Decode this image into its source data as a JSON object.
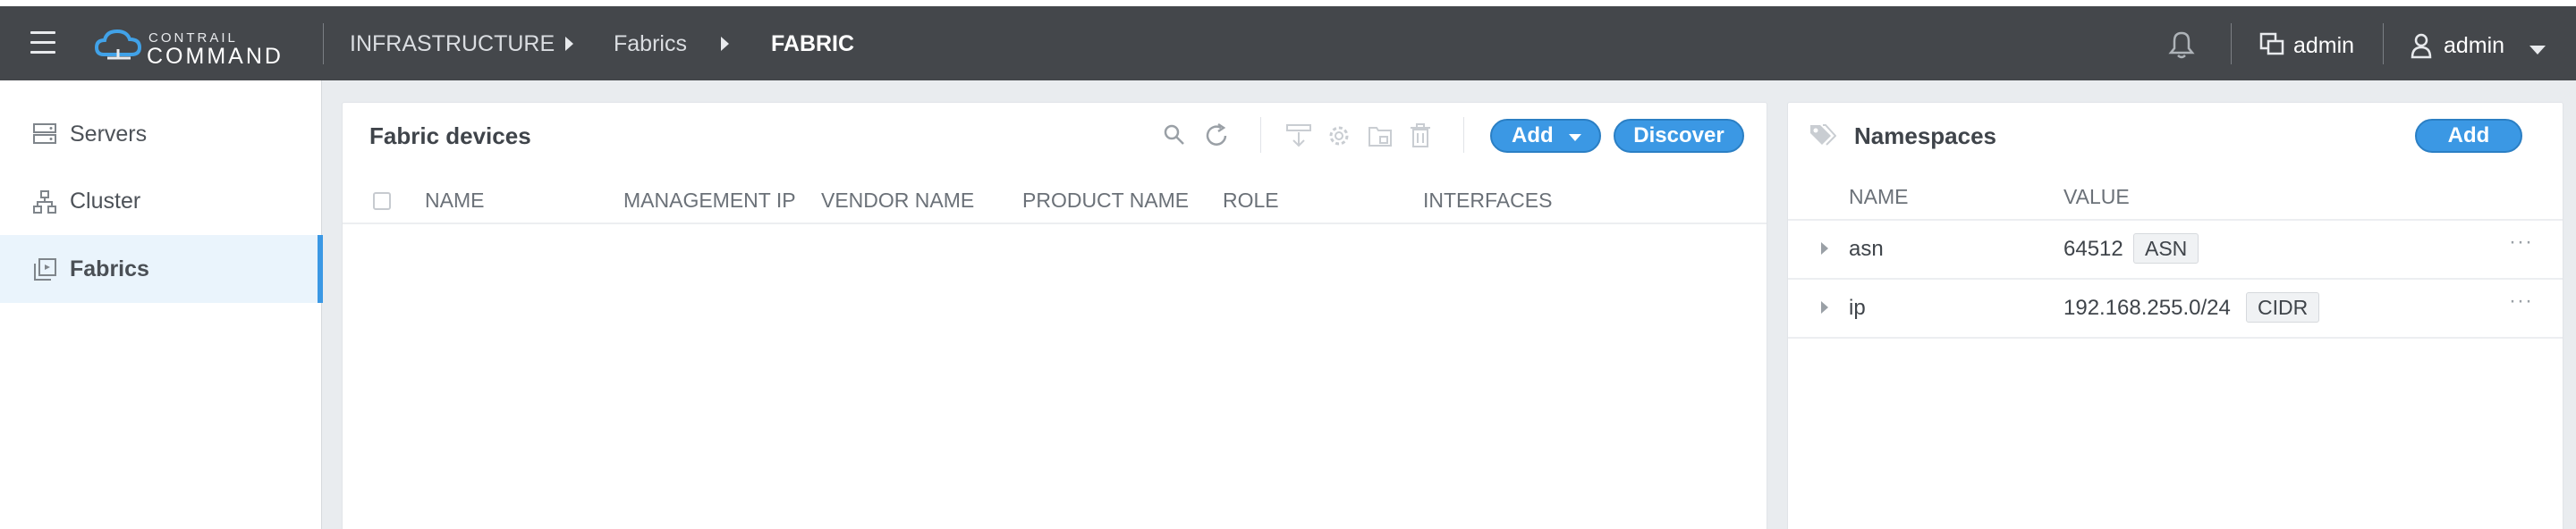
{
  "app": {
    "logo_top": "CONTRAIL",
    "logo_bottom": "COMMAND"
  },
  "breadcrumb": [
    "INFRASTRUCTURE",
    "Fabrics",
    "FABRIC"
  ],
  "header": {
    "tenant_label": "admin",
    "user_label": "admin"
  },
  "sidebar": {
    "items": [
      {
        "label": "Servers",
        "icon": "servers-icon"
      },
      {
        "label": "Cluster",
        "icon": "cluster-icon"
      },
      {
        "label": "Fabrics",
        "icon": "fabrics-icon",
        "active": true
      }
    ]
  },
  "fabric_devices": {
    "title": "Fabric devices",
    "add_label": "Add",
    "discover_label": "Discover",
    "columns": [
      "NAME",
      "MANAGEMENT IP",
      "VENDOR NAME",
      "PRODUCT NAME",
      "ROLE",
      "INTERFACES"
    ],
    "rows": []
  },
  "namespaces": {
    "title": "Namespaces",
    "add_label": "Add",
    "columns": [
      "NAME",
      "VALUE"
    ],
    "rows": [
      {
        "name": "asn",
        "value": "64512",
        "tag": "ASN"
      },
      {
        "name": "ip",
        "value": "192.168.255.0/24",
        "tag": "CIDR"
      }
    ]
  },
  "colors": {
    "header_bg": "#44474b",
    "accent": "#3b98e4",
    "active_bg": "#eaf4fc"
  }
}
